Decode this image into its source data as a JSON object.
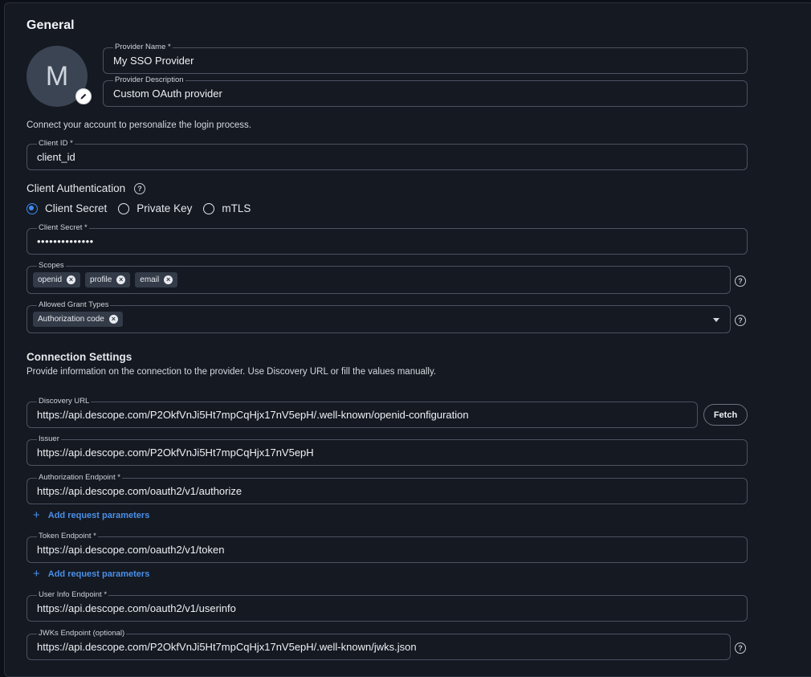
{
  "general": {
    "title": "General",
    "avatar_initial": "M"
  },
  "provider_name": {
    "label": "Provider Name *",
    "value": "My SSO Provider"
  },
  "provider_description": {
    "label": "Provider Description",
    "value": "Custom OAuth provider"
  },
  "connect_text": "Connect your account to personalize the login process.",
  "client_id": {
    "label": "Client ID *",
    "value": "client_id"
  },
  "client_auth": {
    "title": "Client Authentication",
    "options": [
      "Client Secret",
      "Private Key",
      "mTLS"
    ],
    "selected": "Client Secret"
  },
  "client_secret": {
    "label": "Client Secret *",
    "value": "••••••••••••••"
  },
  "scopes": {
    "label": "Scopes",
    "chips": [
      "openid",
      "profile",
      "email"
    ]
  },
  "grant_types": {
    "label": "Allowed Grant Types",
    "chips": [
      "Authorization code"
    ]
  },
  "connection": {
    "title": "Connection Settings",
    "description": "Provide information on the connection to the provider. Use Discovery URL or fill the values manually."
  },
  "discovery_url": {
    "label": "Discovery URL",
    "value": "https://api.descope.com/P2OkfVnJi5Ht7mpCqHjx17nV5epH/.well-known/openid-configuration",
    "button": "Fetch"
  },
  "issuer": {
    "label": "Issuer",
    "value": "https://api.descope.com/P2OkfVnJi5Ht7mpCqHjx17nV5epH"
  },
  "authorization_endpoint": {
    "label": "Authorization Endpoint *",
    "value": "https://api.descope.com/oauth2/v1/authorize",
    "add_params": "Add request parameters"
  },
  "token_endpoint": {
    "label": "Token Endpoint *",
    "value": "https://api.descope.com/oauth2/v1/token",
    "add_params": "Add request parameters"
  },
  "userinfo_endpoint": {
    "label": "User Info Endpoint *",
    "value": "https://api.descope.com/oauth2/v1/userinfo"
  },
  "jwks_endpoint": {
    "label": "JWKs Endpoint (optional)",
    "value": "https://api.descope.com/P2OkfVnJi5Ht7mpCqHjx17nV5epH/.well-known/jwks.json"
  },
  "colors": {
    "accent": "#3b8bf5",
    "link": "#4a8fe8",
    "background": "#141922",
    "border": "#4b5361"
  },
  "icons": {
    "edit": "pencil-icon",
    "help": "help-circle-icon",
    "remove": "close-circle-icon",
    "dropdown": "caret-down-icon",
    "add": "plus-icon"
  }
}
